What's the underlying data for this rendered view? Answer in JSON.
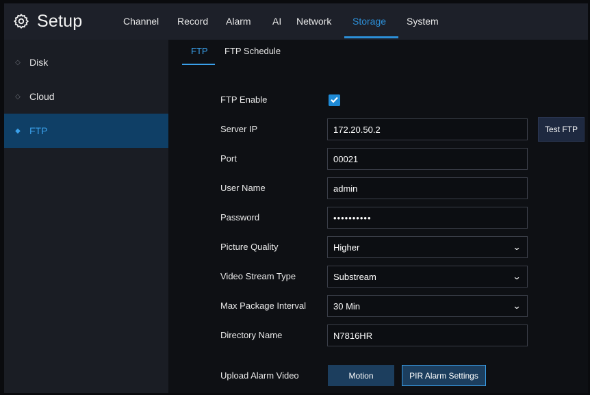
{
  "header": {
    "title": "Setup",
    "tabs": [
      "Channel",
      "Record",
      "Alarm",
      "AI",
      "Network",
      "Storage",
      "System"
    ],
    "active_tab": "Storage"
  },
  "sidebar": {
    "items": [
      {
        "label": "Disk"
      },
      {
        "label": "Cloud"
      },
      {
        "label": "FTP"
      }
    ],
    "active": "FTP"
  },
  "subtabs": [
    "FTP",
    "FTP Schedule"
  ],
  "form": {
    "ftp_enable": {
      "label": "FTP Enable",
      "checked": true
    },
    "server_ip": {
      "label": "Server IP",
      "value": "172.20.50.2",
      "button": "Test FTP"
    },
    "port": {
      "label": "Port",
      "value": "00021"
    },
    "user_name": {
      "label": "User Name",
      "value": "admin"
    },
    "password": {
      "label": "Password",
      "value": "••••••••••"
    },
    "picture_quality": {
      "label": "Picture Quality",
      "value": "Higher"
    },
    "video_stream_type": {
      "label": "Video Stream Type",
      "value": "Substream"
    },
    "max_package_interval": {
      "label": "Max Package Interval",
      "value": "30 Min"
    },
    "directory_name": {
      "label": "Directory Name",
      "value": "N7816HR"
    },
    "upload_alarm_video": {
      "label": "Upload Alarm Video",
      "buttons": [
        "Motion",
        "PIR Alarm Settings"
      ]
    }
  },
  "colors": {
    "accent": "#2c8fd8",
    "sidebar_active": "#0f3f66",
    "checkbox": "#1e8ad6"
  }
}
